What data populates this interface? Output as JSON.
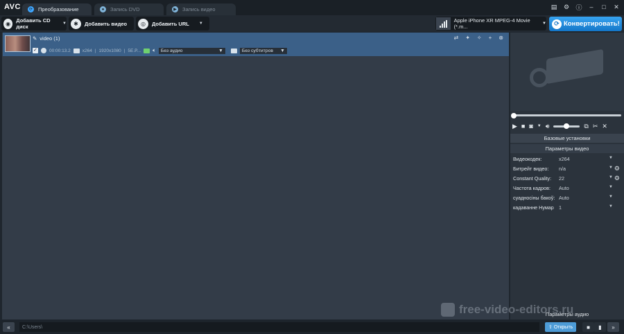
{
  "app": {
    "logo": "AVC"
  },
  "tabs": [
    {
      "label": "Преобразование",
      "state": "active"
    },
    {
      "label": "Запись DVD",
      "state": "inactive"
    },
    {
      "label": "Запись видео",
      "state": "inactive"
    }
  ],
  "toolbar": {
    "add_cd": "Добавить CD диск",
    "add_video": "Добавить видео",
    "add_url": "Добавить URL",
    "profile": "Apple iPhone XR MPEG-4 Movie (*.m...",
    "convert": "Конвертировать!"
  },
  "file": {
    "name": "video (1)",
    "duration": "00:00:13.2",
    "codec": "x264",
    "resolution": "1920x1080",
    "bitrate": "5E.P...",
    "audio": "Без аудио",
    "subtitles": "Без субтитров"
  },
  "panel": {
    "basic_settings": "Базовые установки",
    "video_params": "Параметры видео",
    "params": [
      {
        "label": "Видеокодек:",
        "value": "x264",
        "gear": false
      },
      {
        "label": "Битрейт видео:",
        "value": "n/a",
        "gear": true
      },
      {
        "label": "Constant Quality:",
        "value": "22",
        "gear": true
      },
      {
        "label": "Частота кадров:",
        "value": "Auto",
        "gear": false
      },
      {
        "label": "суадносіны бакоў:",
        "value": "Auto",
        "gear": false
      },
      {
        "label": "кадаванне Нумар",
        "value": "1",
        "gear": false
      }
    ],
    "audio_params": "Параметры аудио"
  },
  "status": {
    "path": "C:\\Users\\",
    "open": "Открыть"
  },
  "watermark": "free-video-editors.ru",
  "colors": {
    "accent": "#1a8de0",
    "row_selected": "#3b6088",
    "background": "#333c48"
  }
}
